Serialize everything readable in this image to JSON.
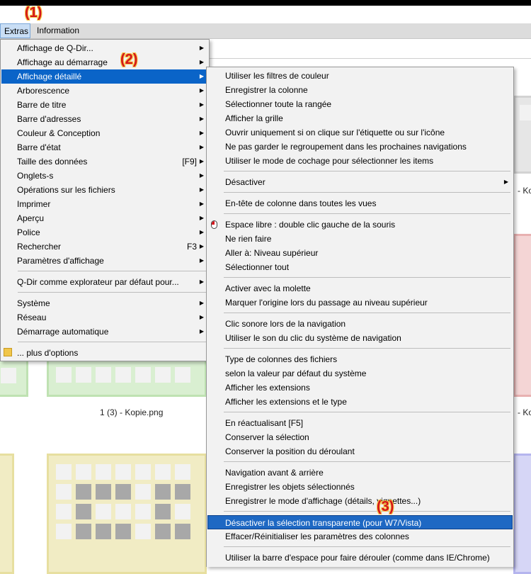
{
  "callouts": [
    "(1)",
    "(2)",
    "(3)"
  ],
  "menubar": {
    "items": [
      "Extras",
      "Information"
    ]
  },
  "main_menu": {
    "items": [
      {
        "label": "Affichage de Q-Dir...",
        "arrow": true
      },
      {
        "label": "Affichage au démarrage",
        "arrow": true
      },
      {
        "label": "Affichage détaillé",
        "arrow": true,
        "selected": true
      },
      {
        "label": "Arborescence",
        "arrow": true
      },
      {
        "label": "Barre de titre",
        "arrow": true
      },
      {
        "label": "Barre d'adresses",
        "arrow": true
      },
      {
        "label": "Couleur & Conception",
        "arrow": true
      },
      {
        "label": "Barre d'état",
        "arrow": true
      },
      {
        "label": "Taille des données",
        "shortcut": "[F9]",
        "arrow": true
      },
      {
        "label": "Onglets-s",
        "arrow": true
      },
      {
        "label": "Opérations sur les fichiers",
        "arrow": true
      },
      {
        "label": "Imprimer",
        "arrow": true
      },
      {
        "label": "Aperçu",
        "arrow": true
      },
      {
        "label": "Police",
        "arrow": true
      },
      {
        "label": "Rechercher",
        "shortcut": "F3",
        "arrow": true
      },
      {
        "label": "Paramètres d'affichage",
        "arrow": true
      },
      {
        "label": "Q-Dir comme explorateur par défaut pour...",
        "arrow": true
      },
      {
        "label": "Système",
        "arrow": true
      },
      {
        "label": "Réseau",
        "arrow": true
      },
      {
        "label": "Démarrage automatique",
        "arrow": true
      },
      {
        "label": "... plus d'options",
        "icon": "folder-icon"
      }
    ]
  },
  "sub_menu": {
    "items": [
      {
        "label": "Utiliser les filtres de couleur"
      },
      {
        "label": "Enregistrer la colonne"
      },
      {
        "label": "Sélectionner toute la rangée"
      },
      {
        "label": "Afficher la grille"
      },
      {
        "label": "Ouvrir uniquement si on clique sur l'étiquette ou sur l'icône"
      },
      {
        "label": "Ne pas garder le regroupement dans les prochaines navigations"
      },
      {
        "label": "Utiliser le mode de cochage pour sélectionner les items"
      },
      {
        "label": "Désactiver",
        "arrow": true
      },
      {
        "label": "En-tête de colonne dans toutes les vues"
      },
      {
        "label": "Espace libre : double clic gauche de la souris",
        "icon": "mouse-icon"
      },
      {
        "label": "Ne rien faire"
      },
      {
        "label": "Aller à: Niveau supérieur"
      },
      {
        "label": "Sélectionner tout"
      },
      {
        "label": "Activer avec la molette"
      },
      {
        "label": "Marquer l'origine lors du passage au niveau supérieur"
      },
      {
        "label": "Clic sonore lors de la navigation"
      },
      {
        "label": "Utiliser le son du clic du système de navigation"
      },
      {
        "label": "Type de colonnes des fichiers"
      },
      {
        "label": "selon la valeur par défaut du système"
      },
      {
        "label": "Afficher les extensions"
      },
      {
        "label": "Afficher les extensions et le type"
      },
      {
        "label": "En réactualisant [F5]"
      },
      {
        "label": "Conserver la sélection"
      },
      {
        "label": "Conserver la position du déroulant"
      },
      {
        "label": "Navigation avant & arrière"
      },
      {
        "label": "Enregistrer les objets sélectionnés"
      },
      {
        "label": "Enregistrer le mode d'affichage (détails, vignettes...)"
      },
      {
        "label": "Désactiver la sélection transparente (pour W7/Vista)",
        "selected": true
      },
      {
        "label": "Effacer/Réinitialiser les paramètres des colonnes"
      },
      {
        "label": "Utiliser la barre d'espace pour faire dérouler (comme dans IE/Chrome)"
      }
    ]
  },
  "file_view": {
    "captions": [
      "1 (3) - Kopie.png",
      "- Ko",
      "- Ko"
    ]
  }
}
